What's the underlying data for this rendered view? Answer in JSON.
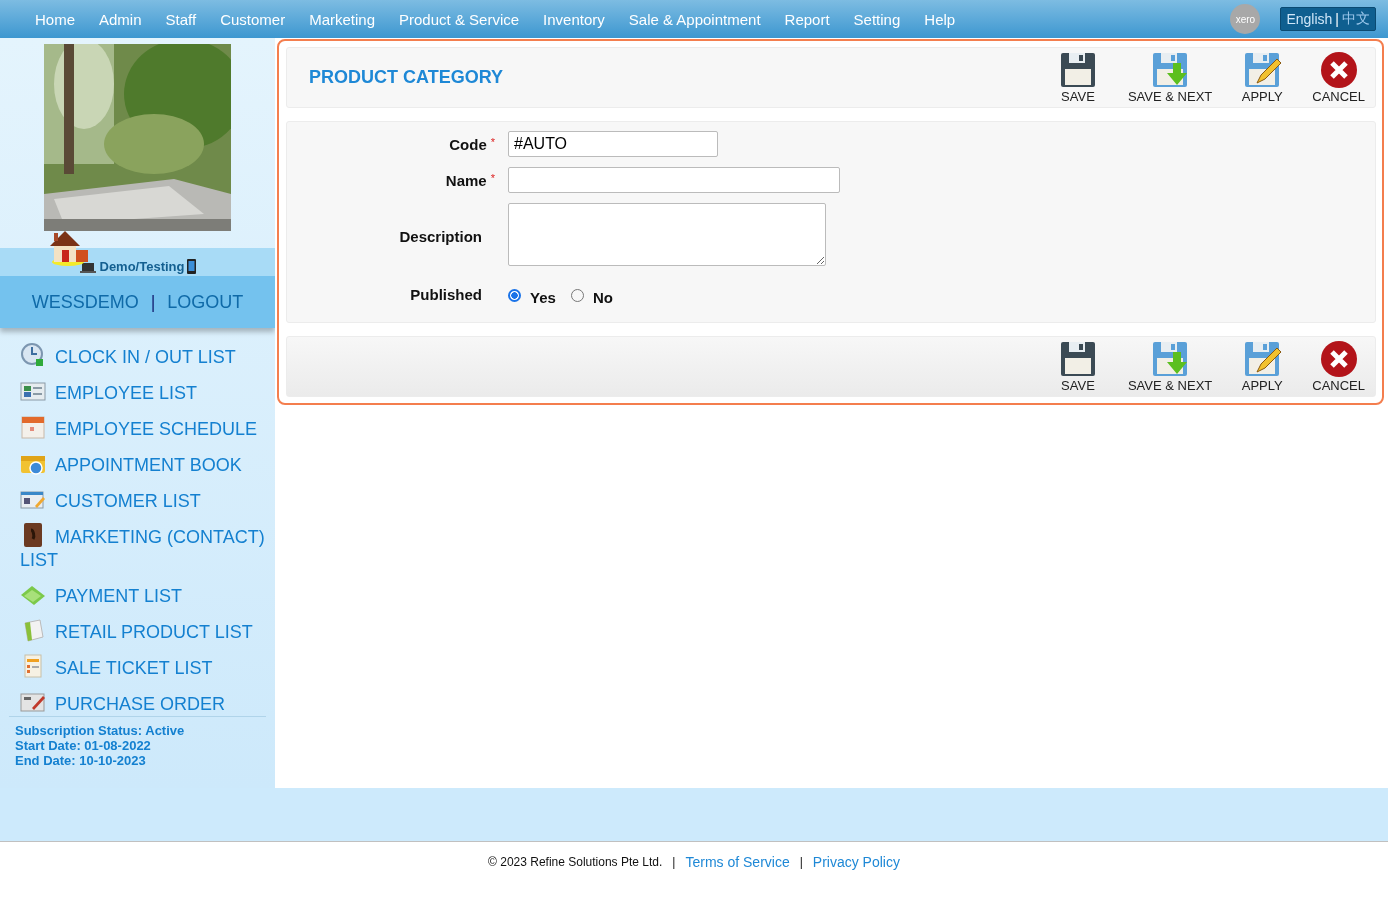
{
  "nav": [
    {
      "label": "Home"
    },
    {
      "label": "Admin"
    },
    {
      "label": "Staff"
    },
    {
      "label": "Customer"
    },
    {
      "label": "Marketing"
    },
    {
      "label": "Product & Service"
    },
    {
      "label": "Inventory"
    },
    {
      "label": "Sale & Appointment"
    },
    {
      "label": "Report"
    },
    {
      "label": "Setting"
    },
    {
      "label": "Help"
    }
  ],
  "xero": "xero",
  "language": {
    "options": [
      {
        "label": "English",
        "selected": true
      },
      {
        "label": "中文",
        "selected": false
      }
    ],
    "separator": "|"
  },
  "user": {
    "environment": "Demo/Testing",
    "username": "WESSDEMO",
    "separator": "|",
    "logout": "LOGOUT"
  },
  "sidebar": {
    "items": [
      {
        "label": "CLOCK IN / OUT LIST"
      },
      {
        "label": "EMPLOYEE LIST"
      },
      {
        "label": "EMPLOYEE SCHEDULE"
      },
      {
        "label": "APPOINTMENT BOOK"
      },
      {
        "label": "CUSTOMER LIST"
      },
      {
        "label": "MARKETING (CONTACT) LIST"
      },
      {
        "label": "PAYMENT LIST"
      },
      {
        "label": "RETAIL PRODUCT LIST"
      },
      {
        "label": "SALE TICKET LIST"
      },
      {
        "label": "PURCHASE ORDER"
      }
    ],
    "subscription": [
      "Subscription Status: Active",
      "Start Date: 01-08-2022",
      "End Date: 10-10-2023"
    ]
  },
  "page": {
    "title": "PRODUCT CATEGORY",
    "toolbar": [
      {
        "kind": "save",
        "label": "SAVE"
      },
      {
        "kind": "save_next",
        "label": "SAVE & NEXT"
      },
      {
        "kind": "apply",
        "label": "APPLY"
      },
      {
        "kind": "cancel",
        "label": "CANCEL"
      }
    ],
    "fields": [
      {
        "kind": "text",
        "label": "Code",
        "mark": "*",
        "value": "#AUTO"
      },
      {
        "kind": "wide",
        "label": "Name",
        "mark": "*"
      },
      {
        "kind": "textarea",
        "label": "Description"
      },
      {
        "kind": "radio",
        "label": "Published",
        "options": [
          {
            "label": "Yes",
            "selected": true
          },
          {
            "label": "No",
            "selected": false
          }
        ]
      }
    ],
    "bottom_toolbar": [
      {
        "kind": "save",
        "label": "SAVE"
      },
      {
        "kind": "save_next",
        "label": "SAVE & NEXT"
      },
      {
        "kind": "apply",
        "label": "APPLY"
      },
      {
        "kind": "cancel",
        "label": "CANCEL"
      }
    ]
  },
  "footer": {
    "copyright": "© 2023 Refine Solutions Pte Ltd.",
    "separator": "|",
    "links": [
      {
        "label": "Terms of Service"
      },
      {
        "label": "Privacy Policy"
      }
    ]
  }
}
